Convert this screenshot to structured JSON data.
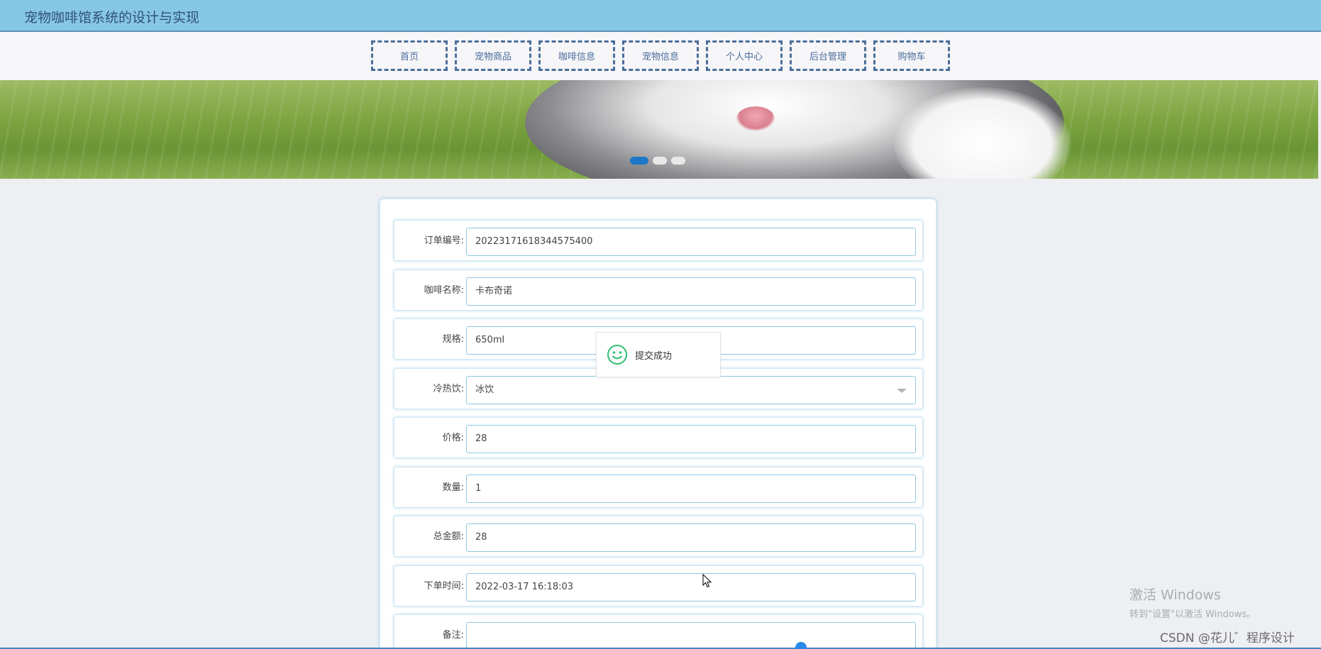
{
  "app": {
    "title": "宠物咖啡馆系统的设计与实现"
  },
  "nav": {
    "items": [
      {
        "label": "首页"
      },
      {
        "label": "宠物商品"
      },
      {
        "label": "咖啡信息"
      },
      {
        "label": "宠物信息"
      },
      {
        "label": "个人中心"
      },
      {
        "label": "后台管理"
      },
      {
        "label": "购物车"
      }
    ]
  },
  "banner": {
    "slide_count": 3,
    "active_slide": 1
  },
  "form": {
    "fields": [
      {
        "label": "订单编号:",
        "value": "20223171618344575400",
        "type": "text"
      },
      {
        "label": "咖啡名称:",
        "value": "卡布奇诺",
        "type": "text"
      },
      {
        "label": "规格:",
        "value": "650ml",
        "type": "text"
      },
      {
        "label": "冷热饮:",
        "value": "冰饮",
        "type": "select"
      },
      {
        "label": "价格:",
        "value": "28",
        "type": "text"
      },
      {
        "label": "数量:",
        "value": "1",
        "type": "text"
      },
      {
        "label": "总金额:",
        "value": "28",
        "type": "text"
      },
      {
        "label": "下单时间:",
        "value": "2022-03-17 16:18:03",
        "type": "text"
      },
      {
        "label": "备注:",
        "value": "",
        "type": "text"
      }
    ]
  },
  "toast": {
    "message": "提交成功",
    "icon": "smile-icon",
    "color": "#2fbf71"
  },
  "watermark": {
    "line1": "激活 Windows",
    "line2": "转到\"设置\"以激活 Windows。"
  },
  "credit": {
    "text": "CSDN @花儿゛程序设计"
  },
  "colors": {
    "topbar": "#87c7e6",
    "nav_border": "#4a6e9b",
    "active_dot": "#1d78c9",
    "field_border": "#8fc5e0"
  }
}
